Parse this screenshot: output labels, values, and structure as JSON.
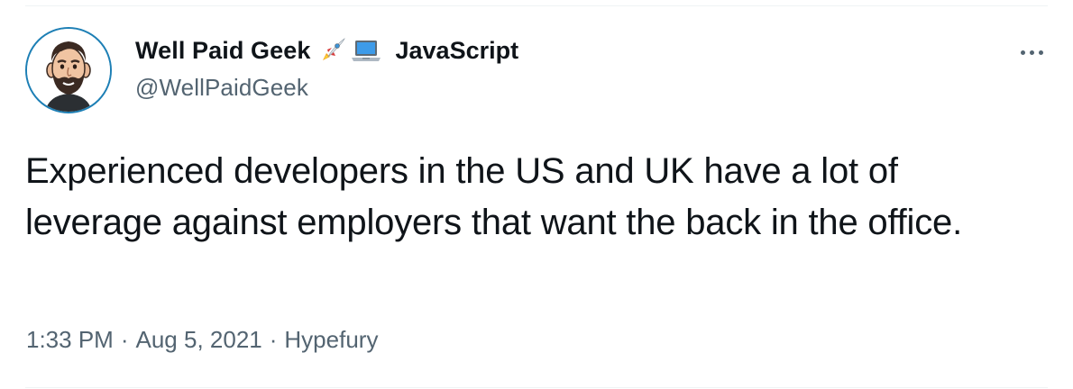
{
  "tweet": {
    "display_name": "Well Paid Geek",
    "name_suffix": "JavaScript",
    "name_emojis": [
      "rocket-icon",
      "laptop-icon"
    ],
    "handle": "@WellPaidGeek",
    "text": "Experienced developers in the US and UK have a lot of leverage against employers that want the back in the office.",
    "time": "1:33 PM",
    "date": "Aug 5, 2021",
    "source": "Hypefury",
    "separator": "·"
  },
  "colors": {
    "primary_text": "#0f1419",
    "secondary_text": "#536471",
    "avatar_ring": "#1d7fb5",
    "divider": "#eff3f4"
  },
  "icons": {
    "more": "more-horizontal-icon",
    "avatar": "avatar-cartoon-bearded-man"
  }
}
